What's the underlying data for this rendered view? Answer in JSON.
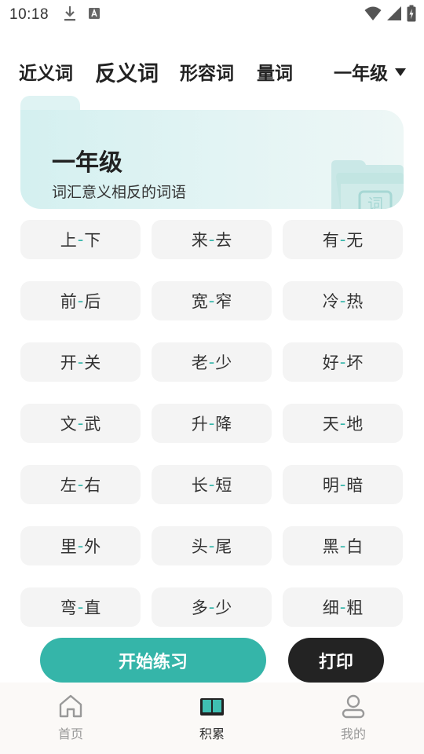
{
  "status_bar": {
    "time": "10:18",
    "icons": [
      "download-icon",
      "a-box-icon",
      "wifi-icon",
      "signal-icon",
      "battery-charging-icon"
    ]
  },
  "tabs": [
    {
      "label": "近义词",
      "active": false
    },
    {
      "label": "反义词",
      "active": true
    },
    {
      "label": "形容词",
      "active": false
    },
    {
      "label": "量词",
      "active": false
    }
  ],
  "grade_select": {
    "value": "一年级",
    "icon": "caret-down-icon"
  },
  "banner": {
    "title": "一年级",
    "subtitle": "词汇意义相反的词语",
    "icon": "folder-document-icon"
  },
  "word_pairs": [
    {
      "a": "上",
      "b": "下"
    },
    {
      "a": "来",
      "b": "去"
    },
    {
      "a": "有",
      "b": "无"
    },
    {
      "a": "前",
      "b": "后"
    },
    {
      "a": "宽",
      "b": "窄"
    },
    {
      "a": "冷",
      "b": "热"
    },
    {
      "a": "开",
      "b": "关"
    },
    {
      "a": "老",
      "b": "少"
    },
    {
      "a": "好",
      "b": "坏"
    },
    {
      "a": "文",
      "b": "武"
    },
    {
      "a": "升",
      "b": "降"
    },
    {
      "a": "天",
      "b": "地"
    },
    {
      "a": "左",
      "b": "右"
    },
    {
      "a": "长",
      "b": "短"
    },
    {
      "a": "明",
      "b": "暗"
    },
    {
      "a": "里",
      "b": "外"
    },
    {
      "a": "头",
      "b": "尾"
    },
    {
      "a": "黑",
      "b": "白"
    },
    {
      "a": "弯",
      "b": "直"
    },
    {
      "a": "多",
      "b": "少"
    },
    {
      "a": "细",
      "b": "粗"
    }
  ],
  "separator": "-",
  "actions": {
    "start_label": "开始练习",
    "print_label": "打印"
  },
  "bottom_nav": [
    {
      "label": "首页",
      "icon": "home-icon",
      "active": false
    },
    {
      "label": "积累",
      "icon": "book-icon",
      "active": true
    },
    {
      "label": "我的",
      "icon": "person-icon",
      "active": false
    }
  ],
  "colors": {
    "accent": "#35b5a9",
    "dark_button": "#232323",
    "cell_bg": "#f4f4f4"
  }
}
